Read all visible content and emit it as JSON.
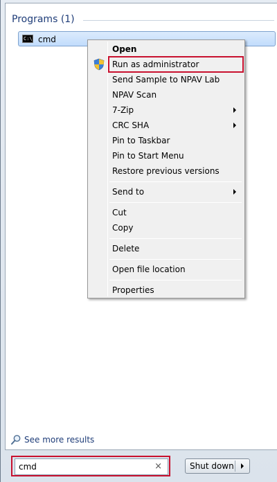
{
  "results": {
    "section_title": "Programs (1)",
    "items": [
      {
        "label": "cmd",
        "icon": "cmd-icon"
      }
    ]
  },
  "context_menu": {
    "items": [
      {
        "label": "Open",
        "bold": true
      },
      {
        "label": "Run as administrator",
        "icon": "uac-shield-icon",
        "highlighted_box_color": "#c8102e"
      },
      {
        "label": "Send Sample to NPAV Lab"
      },
      {
        "label": "NPAV Scan"
      },
      {
        "label": "7-Zip",
        "submenu": true
      },
      {
        "label": "CRC SHA",
        "submenu": true
      },
      {
        "label": "Pin to Taskbar"
      },
      {
        "label": "Pin to Start Menu"
      },
      {
        "label": "Restore previous versions"
      },
      {
        "label": "Send to",
        "submenu": true
      },
      {
        "label": "Cut"
      },
      {
        "label": "Copy"
      },
      {
        "label": "Delete"
      },
      {
        "label": "Open file location"
      },
      {
        "label": "Properties"
      }
    ]
  },
  "footer": {
    "see_more": "See more results",
    "search_value": "cmd",
    "clear_symbol": "×",
    "shutdown_label": "Shut down"
  },
  "colors": {
    "annotation_red": "#c8102e",
    "selection_blue": "#c1dcfc",
    "title_blue": "#1e3c78"
  }
}
